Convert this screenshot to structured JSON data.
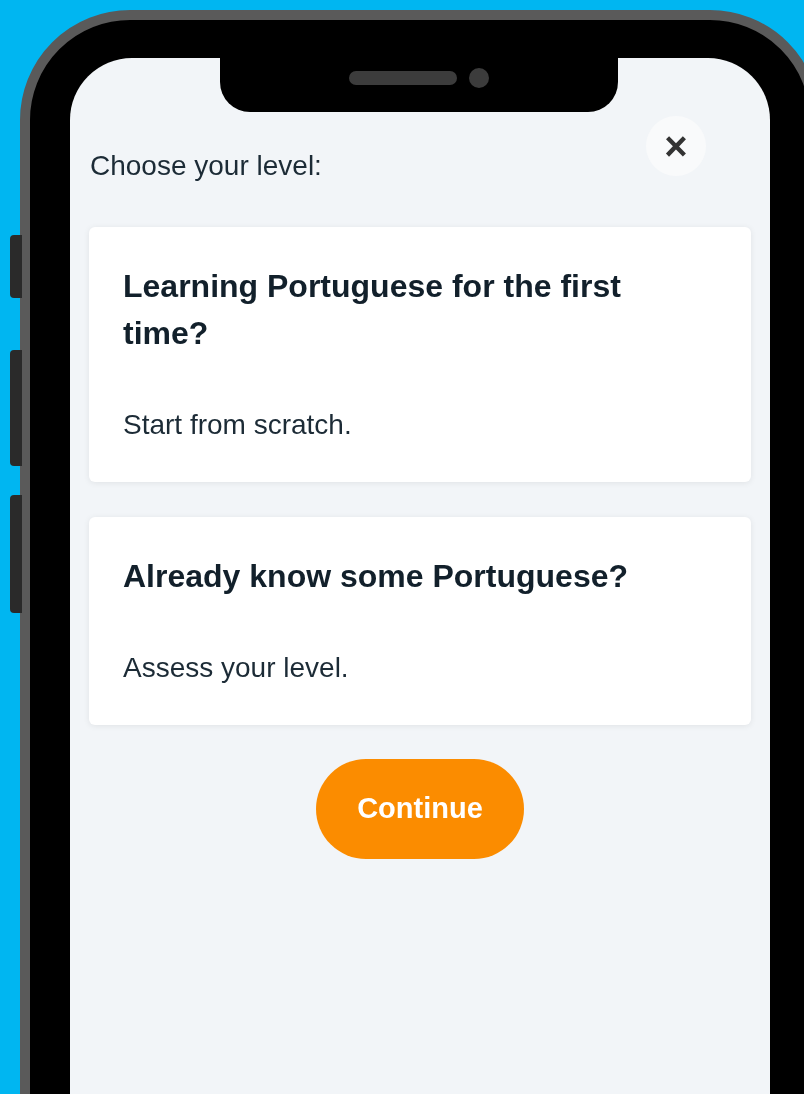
{
  "close_button": {
    "label": "×"
  },
  "prompt": "Choose your level:",
  "options": [
    {
      "title": "Learning Portuguese for the first time?",
      "subtitle": "Start from scratch."
    },
    {
      "title": "Already know some Portuguese?",
      "subtitle": "Assess your level."
    }
  ],
  "continue_button": {
    "label": "Continue"
  }
}
